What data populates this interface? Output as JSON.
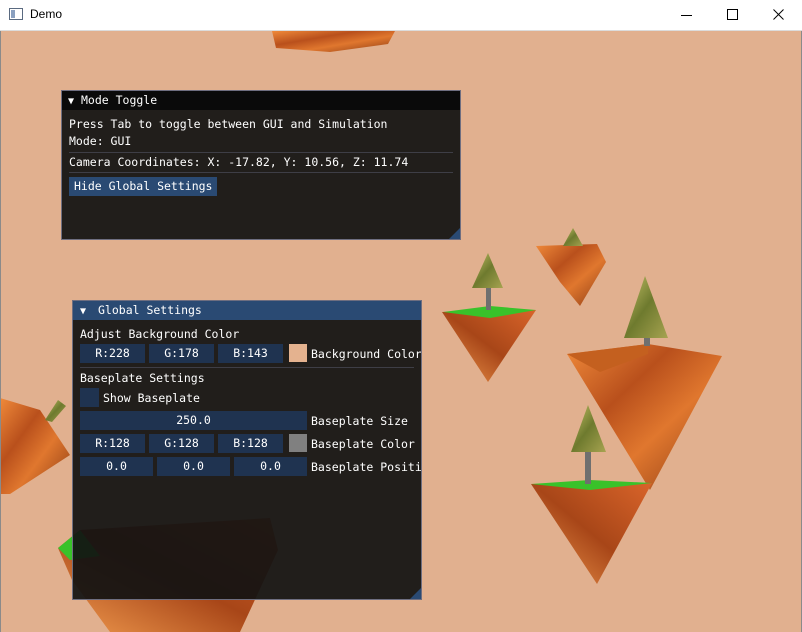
{
  "window": {
    "title": "Demo"
  },
  "colors": {
    "background": "#e1b08f",
    "window_bg": "#121212",
    "title_active": "#2a4a73",
    "button": "#2a4a73",
    "field": "#1f3350",
    "background_swatch": "#e4b28f",
    "baseplate_swatch": "#808080"
  },
  "icons": {
    "minimize": "minimize-icon",
    "maximize": "maximize-icon",
    "close": "close-icon",
    "collapse": "collapse-arrow-icon"
  },
  "mode_toggle": {
    "title": "Mode Toggle",
    "arrow": "▼",
    "instruction": "Press Tab to toggle between GUI and Simulation",
    "mode": "Mode: GUI",
    "camera": "Camera Coordinates: X: -17.82, Y: 10.56, Z: 11.74",
    "hide_button": "Hide Global Settings"
  },
  "global_settings": {
    "title": "Global Settings",
    "arrow": "▼",
    "bg_heading": "Adjust Background Color",
    "bg_r": "R:228",
    "bg_g": "G:178",
    "bg_b": "B:143",
    "bg_label": "Background Color",
    "baseplate_heading": "Baseplate Settings",
    "show_baseplate": "Show Baseplate",
    "show_baseplate_checked": false,
    "size_value": "250.0",
    "size_label": "Baseplate Size",
    "bp_r": "R:128",
    "bp_g": "G:128",
    "bp_b": "B:128",
    "bp_color_label": "Baseplate Color",
    "pos_x": "0.0",
    "pos_y": "0.0",
    "pos_z": "0.0",
    "pos_label": "Baseplate Position"
  }
}
